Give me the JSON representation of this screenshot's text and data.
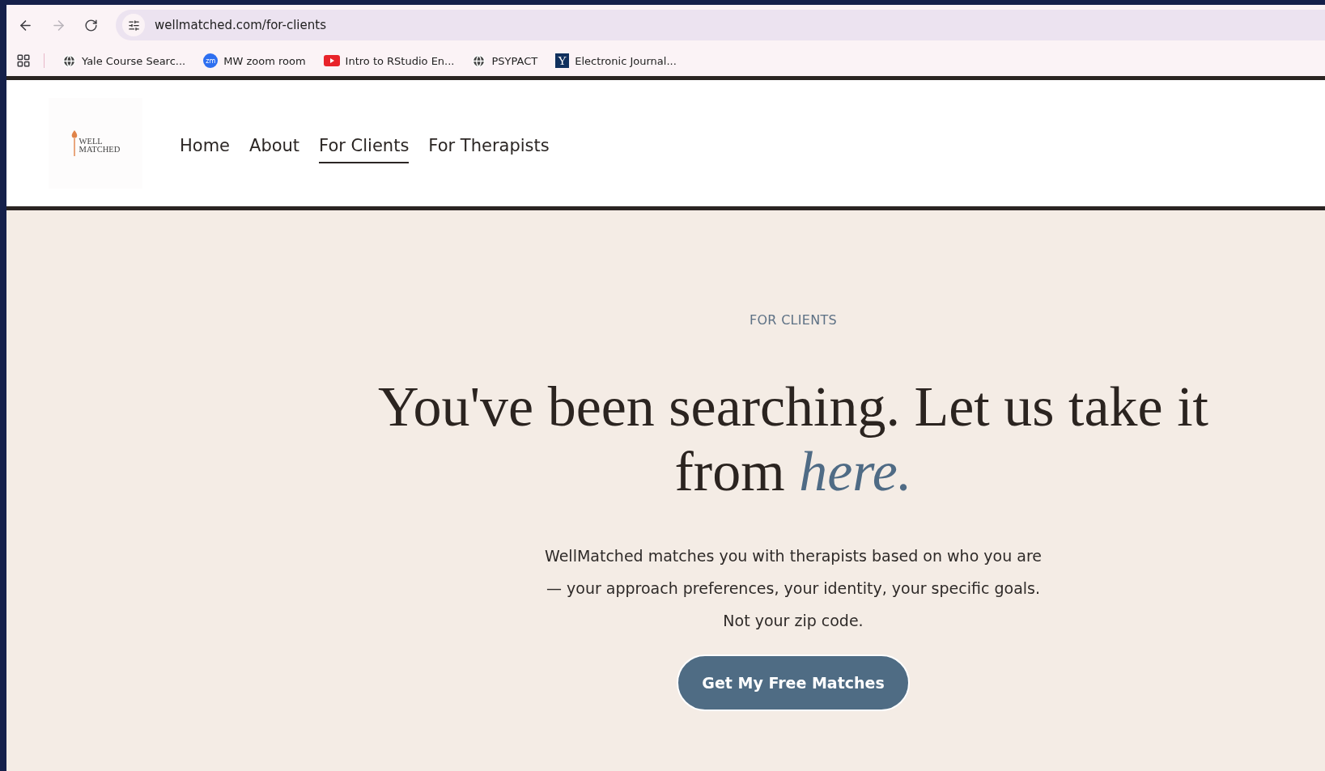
{
  "browser": {
    "url": "wellmatched.com/for-clients",
    "forward_disabled": true
  },
  "bookmarks": [
    {
      "label": "Yale Course Searc...",
      "kind": "globe"
    },
    {
      "label": "MW zoom room",
      "kind": "zoom",
      "icon_text": "zm"
    },
    {
      "label": "Intro to RStudio En...",
      "kind": "video"
    },
    {
      "label": "PSYPACT",
      "kind": "globe"
    },
    {
      "label": "Electronic Journal...",
      "kind": "letter",
      "icon_text": "Y"
    }
  ],
  "site": {
    "logo": [
      "WELL",
      "MATCHED"
    ],
    "nav": [
      {
        "label": "Home",
        "selected": false
      },
      {
        "label": "About",
        "selected": false
      },
      {
        "label": "For Clients",
        "selected": true
      },
      {
        "label": "For Therapists",
        "selected": false
      }
    ]
  },
  "hero": {
    "eyebrow": "FOR CLIENTS",
    "headline": "You've been searching. Let us take it from *here.*",
    "body": "WellMatched matches you with therapists based on who you are — your approach preferences, your identity, your specific goals. Not your zip code.",
    "button": "Get My Free Matches"
  }
}
